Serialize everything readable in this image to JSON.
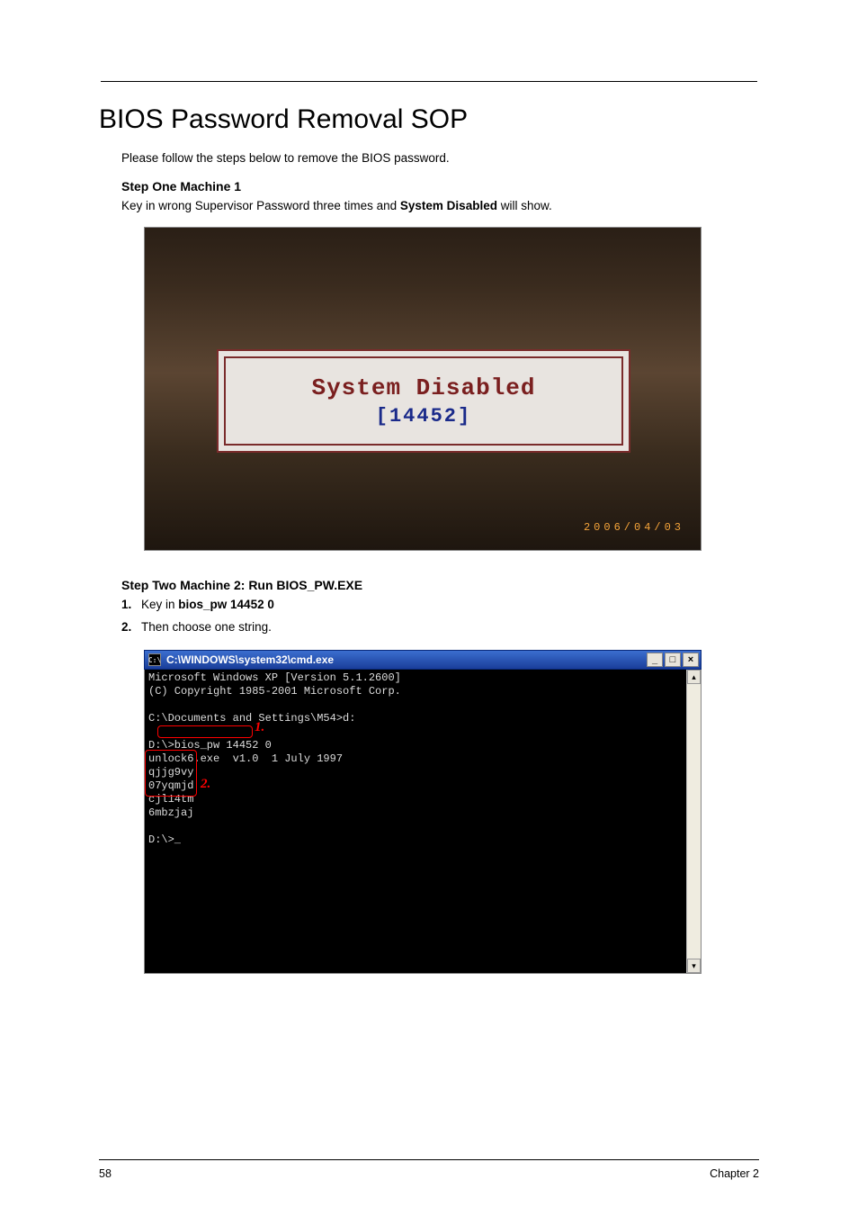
{
  "title": "BIOS Password Removal SOP",
  "intro": "Please follow the steps below to remove the BIOS password.",
  "step1": {
    "heading": "Step One Machine 1",
    "desc_pre": "Key in wrong Supervisor Password three times and ",
    "desc_bold": "System Disabled",
    "desc_post": " will show."
  },
  "figure1": {
    "dialog_line1": "System Disabled",
    "dialog_line2": "[14452]",
    "photo_date": "2006/04/03"
  },
  "step2": {
    "heading": "Step Two Machine 2: Run BIOS_PW.EXE",
    "items": [
      {
        "num": "1.",
        "pre": "Key in ",
        "bold": "bios_pw 14452 0",
        "post": ""
      },
      {
        "num": "2.",
        "pre": "Then choose one string.",
        "bold": "",
        "post": ""
      }
    ]
  },
  "console": {
    "icon_text": "C:\\",
    "titlebar": "C:\\WINDOWS\\system32\\cmd.exe",
    "lines": {
      "l1": "Microsoft Windows XP [Version 5.1.2600]",
      "l2": "(C) Copyright 1985-2001 Microsoft Corp.",
      "blank1": "",
      "l3": "C:\\Documents and Settings\\M54>d:",
      "blank2": "",
      "l4": "D:\\>bios_pw 14452 0",
      "l5": "unlock6.exe  v1.0  1 July 1997",
      "s1": "qjjg9vy",
      "s2": "07yqmjd",
      "s3": "cjl14tm",
      "s4": "6mbzjaj",
      "blank3": "",
      "prompt": "D:\\>_"
    },
    "callouts": {
      "c1": "1.",
      "c2": "2."
    },
    "win_buttons": {
      "min": "_",
      "max": "□",
      "close": "×"
    },
    "scroll": {
      "up": "▴",
      "down": "▾"
    }
  },
  "footer": {
    "page": "58",
    "chapter": "Chapter 2"
  }
}
